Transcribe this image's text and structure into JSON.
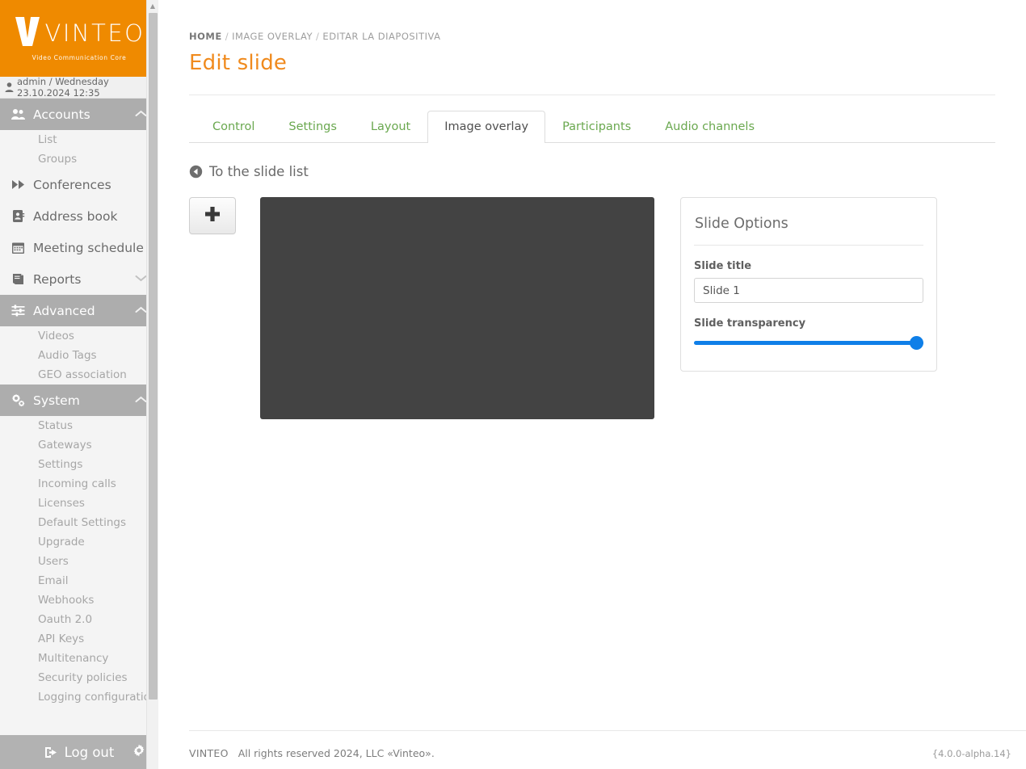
{
  "brand": {
    "name": "VINTEO",
    "tagline": "Video Communication Core",
    "accent_color": "#ef8a00"
  },
  "sidebar": {
    "user_bar": "admin / Wednesday 23.10.2024 12:35",
    "nav": [
      {
        "label": "Accounts",
        "icon": "users-icon",
        "state": "active",
        "chevron": "chevron-up-icon",
        "children": [
          {
            "label": "List"
          },
          {
            "label": "Groups"
          }
        ]
      },
      {
        "label": "Conferences",
        "icon": "forward-icon",
        "state": "plain",
        "chevron": "",
        "children": []
      },
      {
        "label": "Address book",
        "icon": "address-book-icon",
        "state": "plain",
        "chevron": "",
        "children": []
      },
      {
        "label": "Meeting schedule",
        "icon": "calendar-icon",
        "state": "plain",
        "chevron": "",
        "children": []
      },
      {
        "label": "Reports",
        "icon": "book-icon",
        "state": "plain",
        "chevron": "chevron-down-icon",
        "children": []
      },
      {
        "label": "Advanced",
        "icon": "sliders-icon",
        "state": "active",
        "chevron": "chevron-up-icon",
        "children": [
          {
            "label": "Videos"
          },
          {
            "label": "Audio Tags"
          },
          {
            "label": "GEO association"
          }
        ]
      },
      {
        "label": "System",
        "icon": "cogs-icon",
        "state": "active",
        "chevron": "chevron-up-icon",
        "children": [
          {
            "label": "Status"
          },
          {
            "label": "Gateways"
          },
          {
            "label": "Settings"
          },
          {
            "label": "Incoming calls"
          },
          {
            "label": "Licenses"
          },
          {
            "label": "Default Settings"
          },
          {
            "label": "Upgrade"
          },
          {
            "label": "Users"
          },
          {
            "label": "Email"
          },
          {
            "label": "Webhooks"
          },
          {
            "label": "Oauth 2.0"
          },
          {
            "label": "API Keys"
          },
          {
            "label": "Multitenancy"
          },
          {
            "label": "Security policies"
          },
          {
            "label": "Logging configuration"
          }
        ]
      }
    ],
    "logout_label": "Log out",
    "logout_icon": "sign-out-icon",
    "settings_icon": "gear-icon"
  },
  "breadcrumb": [
    {
      "label": "HOME"
    },
    {
      "label": "IMAGE OVERLAY"
    },
    {
      "label": "EDITAR LA DIAPOSITIVA"
    }
  ],
  "page": {
    "title": "Edit slide",
    "back_link": "To the slide list",
    "back_icon": "arrow-circle-left-icon"
  },
  "tabs": [
    {
      "label": "Control",
      "active": false
    },
    {
      "label": "Settings",
      "active": false
    },
    {
      "label": "Layout",
      "active": false
    },
    {
      "label": "Image overlay",
      "active": true
    },
    {
      "label": "Participants",
      "active": false
    },
    {
      "label": "Audio channels",
      "active": false
    }
  ],
  "editor": {
    "add_button_icon": "plus-icon",
    "preview_color": "#434343"
  },
  "options": {
    "heading": "Slide Options",
    "title_label": "Slide title",
    "title_value": "Slide 1",
    "transparency_label": "Slide transparency",
    "transparency_value": 100,
    "slider_color": "#0f7fe8"
  },
  "footer": {
    "brand": "VINTEO",
    "copyright": "All rights reserved 2024, LLC «Vinteo».",
    "version": "{4.0.0-alpha.14}"
  }
}
